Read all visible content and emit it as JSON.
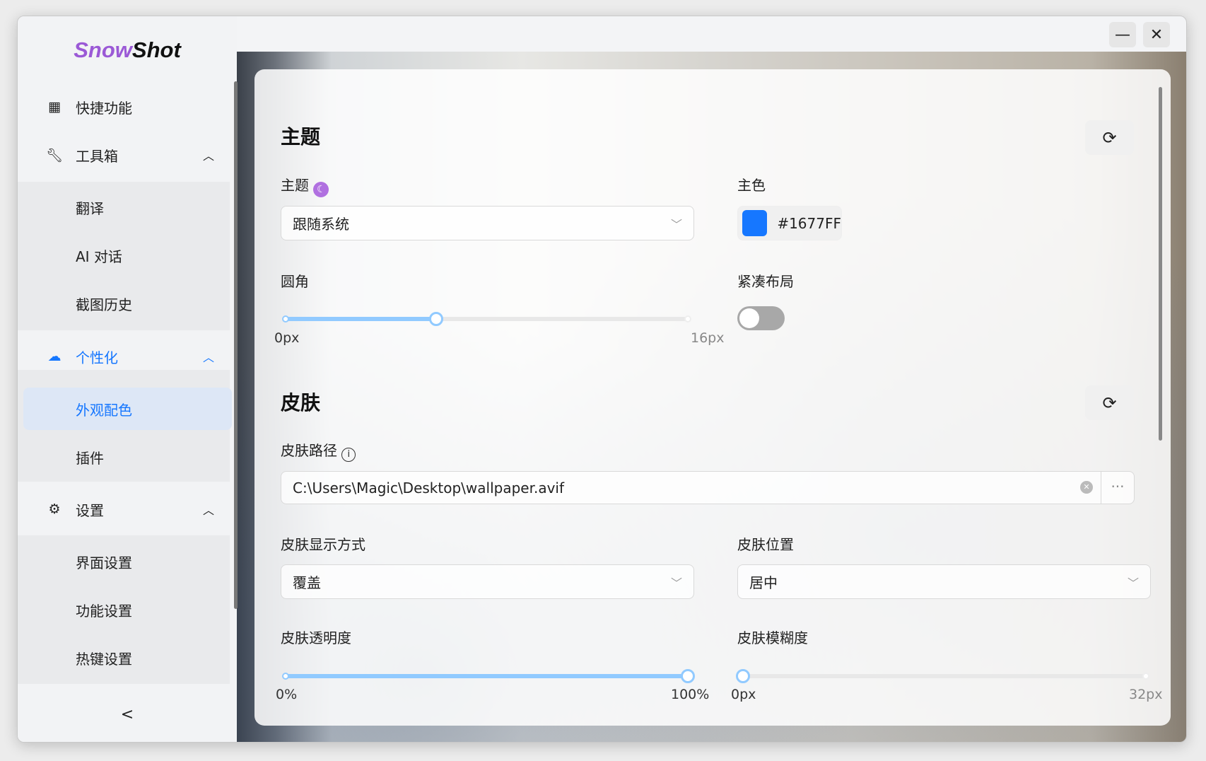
{
  "app": {
    "logo_a": "Snow",
    "logo_b": "Shot"
  },
  "window": {
    "minimize": "—",
    "close": "✕"
  },
  "sidebar": {
    "items": [
      {
        "label": "快捷功能",
        "icon": "grid-icon"
      },
      {
        "label": "工具箱",
        "icon": "wrench-icon"
      },
      {
        "label": "翻译"
      },
      {
        "label": "AI 对话"
      },
      {
        "label": "截图历史"
      },
      {
        "label": "个性化",
        "icon": "palette-icon"
      },
      {
        "label": "外观配色"
      },
      {
        "label": "插件"
      },
      {
        "label": "设置",
        "icon": "gear-icon"
      },
      {
        "label": "界面设置"
      },
      {
        "label": "功能设置"
      },
      {
        "label": "热键设置"
      }
    ],
    "collapse": "<"
  },
  "theme": {
    "title": "主题",
    "theme_label": "主题",
    "theme_value": "跟随系统",
    "primary_label": "主色",
    "primary_value": "#1677FF",
    "primary_color": "#1677FF",
    "radius_label": "圆角",
    "radius_min": "0px",
    "radius_max": "16px",
    "radius_value": 6,
    "radius_range": [
      0,
      16
    ],
    "compact_label": "紧凑布局",
    "compact_on": false
  },
  "skin": {
    "title": "皮肤",
    "path_label": "皮肤路径",
    "path_value": "C:\\Users\\Magic\\Desktop\\wallpaper.avif",
    "more": "···",
    "mode_label": "皮肤显示方式",
    "mode_value": "覆盖",
    "position_label": "皮肤位置",
    "position_value": "居中",
    "opacity_label": "皮肤透明度",
    "opacity_min": "0%",
    "opacity_max": "100%",
    "opacity_value": 100,
    "blur_label": "皮肤模糊度",
    "blur_min": "0px",
    "blur_max": "32px",
    "blur_value": 0,
    "blur_range": [
      0,
      32
    ]
  }
}
